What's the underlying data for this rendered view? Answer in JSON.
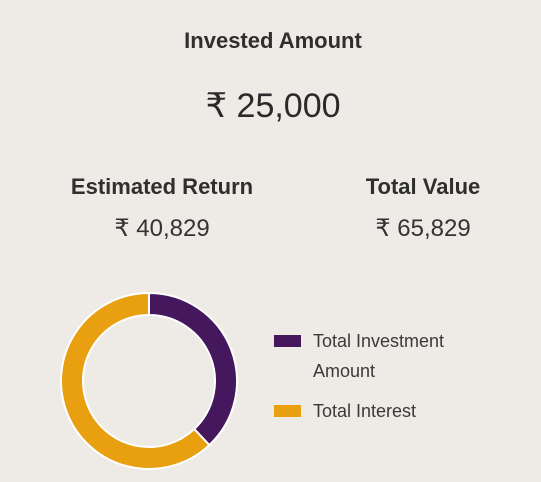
{
  "summary": {
    "invested_label": "Invested Amount",
    "invested_value": "₹ 25,000",
    "return_label": "Estimated Return",
    "return_value": "₹ 40,829",
    "total_label": "Total Value",
    "total_value": "₹ 65,829"
  },
  "colors": {
    "background": "#eeeae6",
    "investment": "#45175d",
    "interest": "#e8a011"
  },
  "chart_data": {
    "type": "pie",
    "categories": [
      "Total Investment Amount",
      "Total Interest"
    ],
    "values": [
      25000,
      40829
    ],
    "colors": [
      "#45175d",
      "#e8a011"
    ],
    "legend": "right"
  },
  "legend": {
    "items": [
      {
        "label": "Total Investment Amount",
        "color": "#45175d"
      },
      {
        "label": "Total Interest",
        "color": "#e8a011"
      }
    ]
  }
}
